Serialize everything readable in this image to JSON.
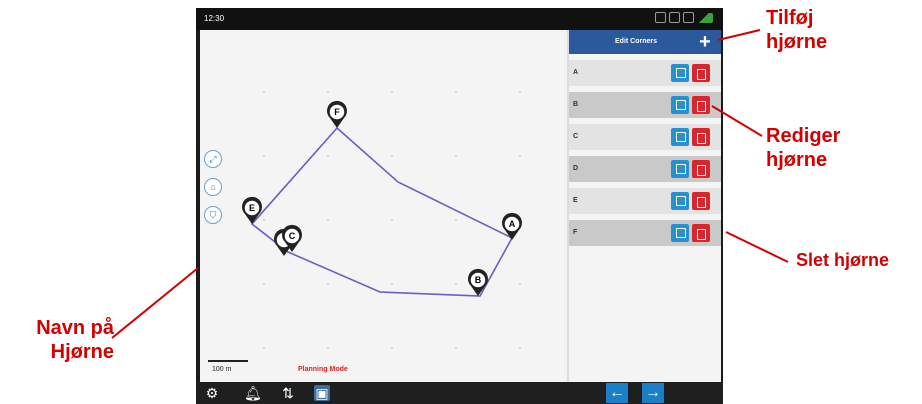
{
  "status_bar": {
    "time": "12:30"
  },
  "map": {
    "corners": [
      {
        "id": "F",
        "label": "F"
      },
      {
        "id": "E",
        "label": "E"
      },
      {
        "id": "C",
        "label": "C"
      },
      {
        "id": "A",
        "label": "A"
      },
      {
        "id": "B",
        "label": "B"
      }
    ],
    "scale_label": "100 m",
    "mode_label": "Planning Mode"
  },
  "panel": {
    "title": "Edit Corners",
    "rows": [
      {
        "label": "A"
      },
      {
        "label": "B"
      },
      {
        "label": "C"
      },
      {
        "label": "D"
      },
      {
        "label": "E"
      },
      {
        "label": "F"
      }
    ]
  },
  "callouts": {
    "add_corner": [
      "Tilføj",
      "hjørne"
    ],
    "edit_corner": [
      "Rediger",
      "hjørne"
    ],
    "delete_corner": "Slet hjørne",
    "corner_name": [
      "Navn på",
      "Hjørne"
    ]
  },
  "colors": {
    "header_blue": "#2b5a9c",
    "edit_blue": "#2690d2",
    "delete_red": "#d8262c",
    "callout_red": "#d40000",
    "path_purple": "#6a5fc0"
  }
}
